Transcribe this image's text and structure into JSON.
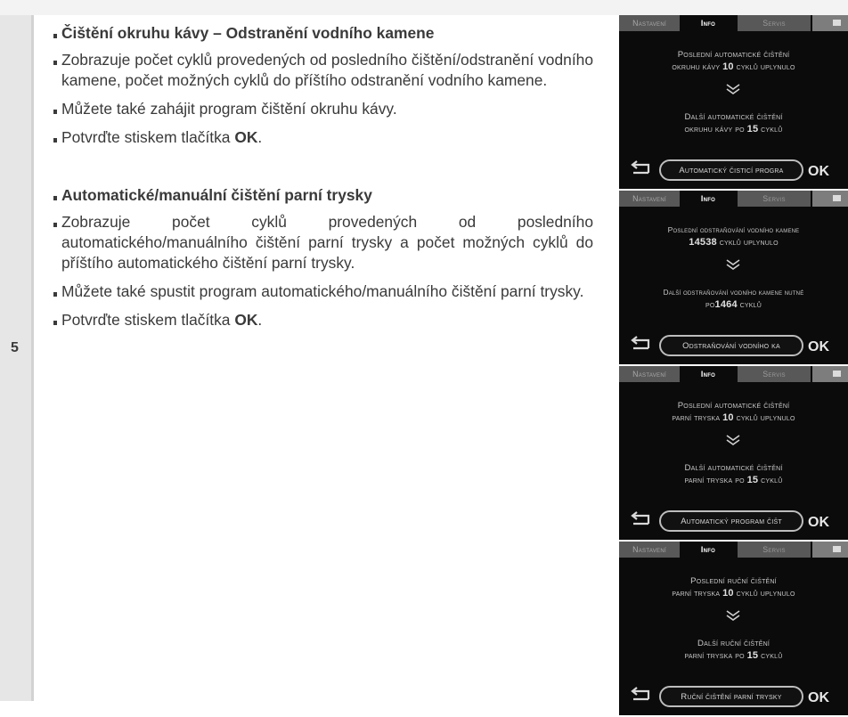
{
  "section_number": "5",
  "blocks": [
    {
      "heading": "Čištění okruhu kávy – Odstranění vodního kamene",
      "para1": "Zobrazuje počet cyklů provedených od posledního čištění/odstranění vodního kamene, počet možných cyklů do příštího odstranění vodního kamene.",
      "para2": "Můžete také zahájit program čištění okruhu kávy.",
      "confirm_prefix": "Potvrďte stiskem tlačítka ",
      "confirm_key": "OK",
      "confirm_suffix": "."
    },
    {
      "heading": "Automatické/manuální čištění parní trysky",
      "para1": "Zobrazuje počet cyklů provedených od posledního automatického/manuálního čištění parní trysky a počet možných cyklů do příštího automatického čištění parní trysky.",
      "para2": "Můžete také spustit program automatického/manuálního čištění parní trysky.",
      "confirm_prefix": "Potvrďte stiskem tlačítka ",
      "confirm_key": "OK",
      "confirm_suffix": "."
    }
  ],
  "tabs": {
    "settings": "Nastavení",
    "info": "Info",
    "service": "Servis"
  },
  "screens": [
    {
      "line1": "Poslední automatické čištění",
      "line2_pre": "okruhu kávy ",
      "line2_num": "10",
      "line2_post": " cyklů uplynulo",
      "line3": "Další automatické čištění",
      "line4_pre": "okruhu kávy po ",
      "line4_num": "15",
      "line4_post": " cyklů",
      "button": "Automatický čisticí progra",
      "ok": "OK"
    },
    {
      "line1": "Poslední odstraňování vodního kamene",
      "line2_pre": "",
      "line2_num": "14538",
      "line2_post": " cyklů uplynulo",
      "line3": "Další odstraňování vodního kamene nutné",
      "line4_pre": "po",
      "line4_num": "1464",
      "line4_post": " cyklů",
      "button": "Odstraňování vodního ka",
      "ok": "OK"
    },
    {
      "line1": "Poslední automatické čištění",
      "line2_pre": "parní tryska ",
      "line2_num": "10",
      "line2_post": " cyklů uplynulo",
      "line3": "Další automatické čištění",
      "line4_pre": "parní tryska po ",
      "line4_num": "15",
      "line4_post": " cyklů",
      "button": "Automatický program čišt",
      "ok": "OK"
    },
    {
      "line1": "Poslední ruční čištění",
      "line2_pre": "parní tryska ",
      "line2_num": "10",
      "line2_post": " cyklů uplynulo",
      "line3": "Další ruční čištění",
      "line4_pre": "parní tryska po ",
      "line4_num": "15",
      "line4_post": " cyklů",
      "button": "Ruční čištění parní trysky",
      "ok": "OK"
    }
  ]
}
